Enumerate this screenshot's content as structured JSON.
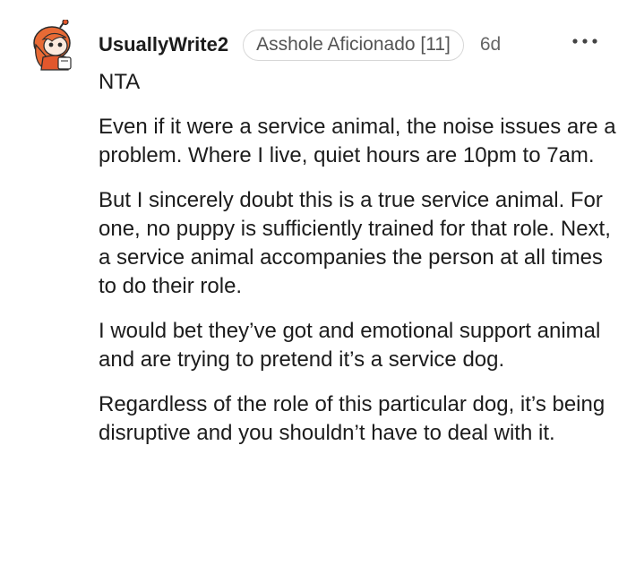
{
  "comment": {
    "author": "UsuallyWrite2",
    "flair": "Asshole Aficionado [11]",
    "age": "6d",
    "avatar_icon": "snoo-avatar-icon",
    "more_icon": "more-options-icon",
    "paragraphs": [
      "NTA",
      "Even if it were a service animal, the noise issues are a problem. Where I live, quiet hours are 10pm to 7am.",
      "But I sincerely doubt this is a true service animal. For one, no puppy is sufficiently trained for that role. Next, a service animal accompanies the person at all times to do their role.",
      "I would bet they’ve got and emotional support animal and are trying to pretend it’s a service dog.",
      "Regardless of the role of this particular dog, it’s being disruptive and you shouldn’t have to deal with it."
    ]
  },
  "colors": {
    "text": "#1c1c1c",
    "meta": "#666666",
    "flair_border": "#d7d7d7",
    "avatar_accent": "#e2572c"
  }
}
